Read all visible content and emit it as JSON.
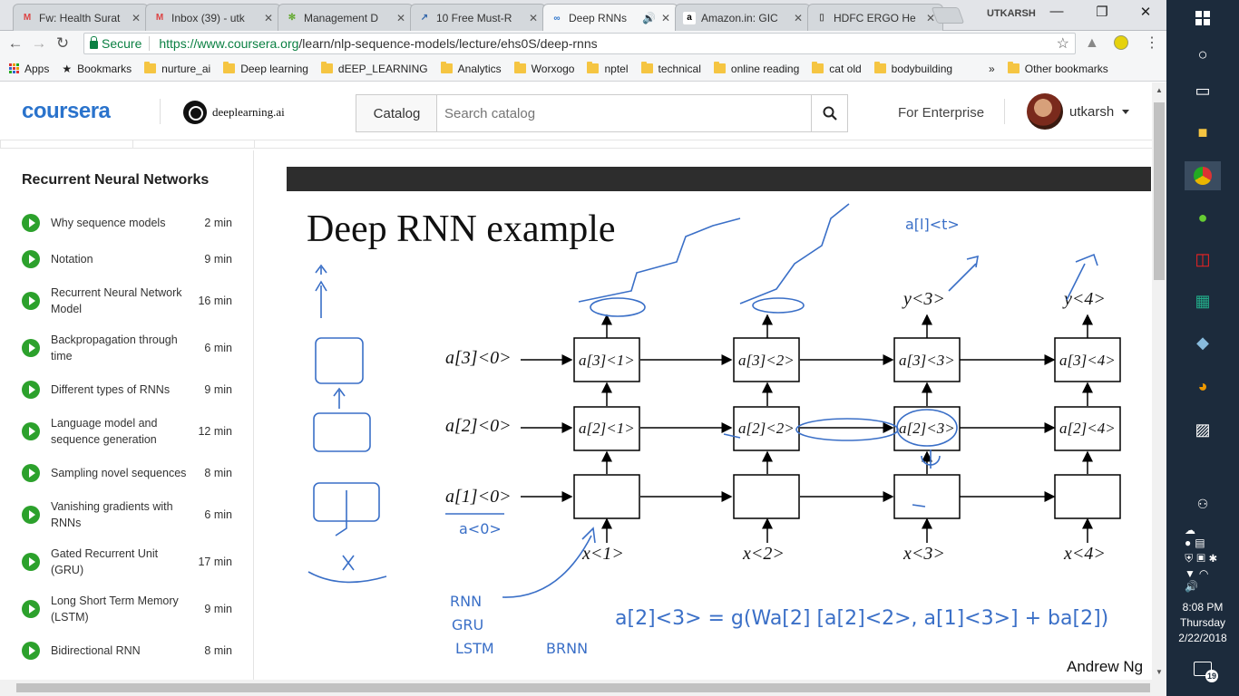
{
  "browser": {
    "tabs": [
      {
        "title": "Fw: Health Surat",
        "favicon": "M"
      },
      {
        "title": "Inbox (39) - utk",
        "favicon": "M"
      },
      {
        "title": "Management D",
        "favicon": "✻"
      },
      {
        "title": "10 Free Must-R",
        "favicon": "↗"
      },
      {
        "title": "Deep RNNs",
        "favicon": "∞"
      },
      {
        "title": "Amazon.in: GIC",
        "favicon": "a"
      },
      {
        "title": "HDFC ERGO He",
        "favicon": "▯"
      }
    ],
    "profile_name": "UTKARSH",
    "secure_label": "Secure",
    "url_base": "https://www.coursera.org",
    "url_path": "/learn/nlp-sequence-models/lecture/ehs0S/deep-rnns",
    "bookmarks": [
      "Apps",
      "Bookmarks",
      "nurture_ai",
      "Deep learning",
      "dEEP_LEARNING",
      "Analytics",
      "Worxogo",
      "nptel",
      "technical",
      "online reading",
      "cat old",
      "bodybuilding"
    ],
    "bookmarks_overflow": "»",
    "other_bookmarks": "Other bookmarks"
  },
  "header": {
    "logo": "coursera",
    "partner": "deeplearning.ai",
    "catalog_label": "Catalog",
    "search_placeholder": "Search catalog",
    "enterprise": "For Enterprise",
    "username": "utkarsh"
  },
  "sidebar": {
    "title": "Recurrent Neural Networks",
    "items": [
      {
        "label": "Why sequence models",
        "duration": "2 min"
      },
      {
        "label": "Notation",
        "duration": "9 min"
      },
      {
        "label": "Recurrent Neural Network Model",
        "duration": "16 min"
      },
      {
        "label": "Backpropagation through time",
        "duration": "6 min"
      },
      {
        "label": "Different types of RNNs",
        "duration": "9 min"
      },
      {
        "label": "Language model and sequence generation",
        "duration": "12 min"
      },
      {
        "label": "Sampling novel sequences",
        "duration": "8 min"
      },
      {
        "label": "Vanishing gradients with RNNs",
        "duration": "6 min"
      },
      {
        "label": "Gated Recurrent Unit (GRU)",
        "duration": "17 min"
      },
      {
        "label": "Long Short Term Memory (LSTM)",
        "duration": "9 min"
      },
      {
        "label": "Bidirectional RNN",
        "duration": "8 min"
      }
    ]
  },
  "slide": {
    "title": "Deep RNN example",
    "author": "Andrew Ng",
    "init_labels": [
      "a[3]<0>",
      "a[2]<0>",
      "a[1]<0>"
    ],
    "cells_layer3": [
      "a[3]<1>",
      "a[3]<2>",
      "a[3]<3>",
      "a[3]<4>"
    ],
    "cells_layer2": [
      "a[2]<1>",
      "a[2]<2>",
      "a[2]<3>",
      "a[2]<4>"
    ],
    "inputs": [
      "x<1>",
      "x<2>",
      "x<3>",
      "x<4>"
    ],
    "outputs": [
      "y<3>",
      "y<4>"
    ],
    "annotations": {
      "a_l_t": "a[l]<t>",
      "a0": "a<0>",
      "variants": [
        "RNN",
        "GRU",
        "LSTM"
      ],
      "brnn": "BRNN",
      "formula": "a[2]<3> = g(Wa[2] [a[2]<2>, a[1]<3>] + ba[2])"
    }
  },
  "taskbar": {
    "time": "8:08 PM",
    "day": "Thursday",
    "date": "2/22/2018",
    "notifications": "19"
  },
  "colors": {
    "accent": "#2a73cc",
    "play": "#2ca12c",
    "ink": "#3a6fc7",
    "taskbar": "#1c2b3c"
  }
}
